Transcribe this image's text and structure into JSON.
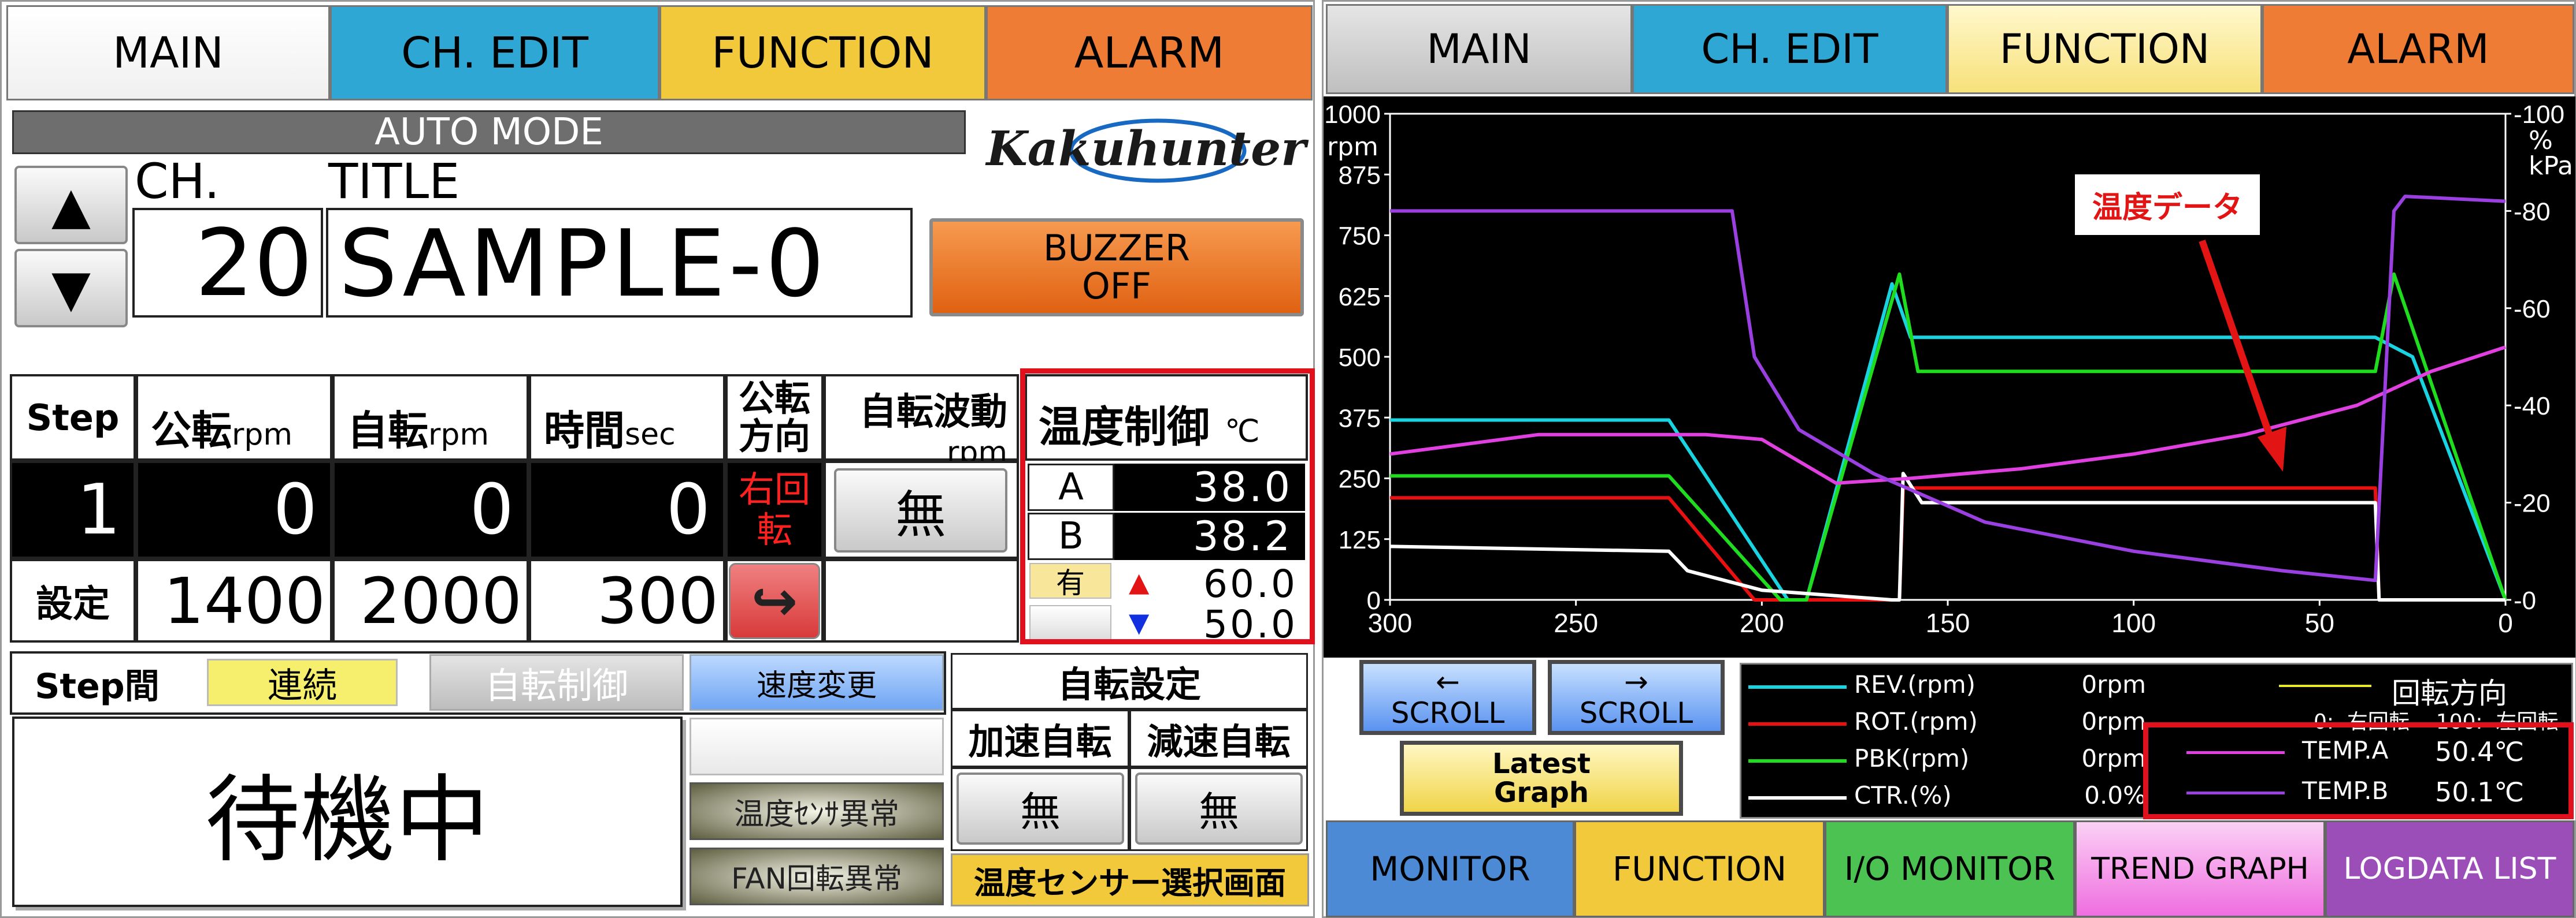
{
  "left": {
    "tabs": [
      "MAIN",
      "CH. EDIT",
      "FUNCTION",
      "ALARM"
    ],
    "mode": "AUTO MODE",
    "logo": "Kakuhunter",
    "ch_label": "CH.",
    "title_label": "TITLE",
    "ch_value": "20",
    "title_value": "SAMPLE-0",
    "up_arrow": "▲",
    "down_arrow": "▼",
    "buzzer": "BUZZER\nOFF",
    "headers": {
      "step": "Step",
      "rev": "公転",
      "rev_unit": "rpm",
      "rot": "自転",
      "rot_unit": "rpm",
      "time": "時間",
      "time_unit": "sec",
      "dir": "公転\n方向",
      "wave": "自転波動",
      "wave_unit": "rpm",
      "temp": "温度制御",
      "temp_unit": "℃"
    },
    "row1": {
      "step": "1",
      "rev": "0",
      "rot": "0",
      "time": "0",
      "dir": "右回\n転",
      "wave": "無"
    },
    "row2": {
      "label": "設定",
      "rev": "1400",
      "rot": "2000",
      "time": "300",
      "dir_icon": "↪"
    },
    "temp": {
      "a_label": "A",
      "a_value": "38.0",
      "b_label": "B",
      "b_value": "38.2",
      "flag": "有",
      "up": "▲",
      "up_value": "60.0",
      "down": "▼",
      "down_value": "50.0"
    },
    "step_between": "Step間",
    "continuous": "連続",
    "rot_control": "自転制御",
    "speed_change": "速度変更",
    "rot_setting": "自転設定",
    "accel": "加速自転",
    "decel": "減速自転",
    "accel_val": "無",
    "decel_val": "無",
    "status": "待機中",
    "sensor_error": "温度ｾﾝｻ異常",
    "fan_error": "FAN回転異常",
    "sensor_select": "温度センサー選択画面"
  },
  "right": {
    "tabs": [
      "MAIN",
      "CH. EDIT",
      "FUNCTION",
      "ALARM"
    ],
    "bottom_tabs": [
      "MONITOR",
      "FUNCTION",
      "I/O MONITOR",
      "TREND GRAPH",
      "LOGDATA LIST"
    ],
    "left_units": "rpm",
    "right_units": "%\nkPa",
    "annotation": "温度データ",
    "scroll_left": "←\nSCROLL",
    "scroll_right": "→\nSCROLL",
    "latest": "Latest\nGraph",
    "legend": [
      {
        "name": "REV.(rpm)",
        "value": "0rpm",
        "color": "#19d3e0"
      },
      {
        "name": "ROT.(rpm)",
        "value": "0rpm",
        "color": "#e81010"
      },
      {
        "name": "PBK(rpm)",
        "value": "0rpm",
        "color": "#1fdc1f"
      },
      {
        "name": "CTR.(%)",
        "value": "0.0%",
        "color": "#ffffff"
      }
    ],
    "dir_title": "回転方向",
    "dir_desc": "0:  右回転    100:  左回転",
    "temp_legend": [
      {
        "name": "TEMP.A",
        "value": "50.4℃",
        "color": "#e040e0"
      },
      {
        "name": "TEMP.B",
        "value": "50.1℃",
        "color": "#9a3fe0"
      }
    ]
  },
  "chart_data": {
    "type": "line",
    "xlim": [
      300,
      0
    ],
    "ylim": [
      0,
      1000
    ],
    "y2lim": [
      0,
      100
    ],
    "x_ticks": [
      "300",
      "250",
      "200",
      "150",
      "100",
      "50",
      "0"
    ],
    "y_ticks": [
      "1000",
      "875",
      "750",
      "625",
      "500",
      "375",
      "250",
      "125",
      "0"
    ],
    "y2_ticks": [
      "100",
      "80",
      "60",
      "40",
      "20",
      "0"
    ],
    "series": [
      {
        "name": "REV.(rpm)",
        "color": "#19d3e0",
        "points": [
          [
            300,
            370
          ],
          [
            225,
            370
          ],
          [
            193,
            0
          ],
          [
            188,
            0
          ],
          [
            165,
            650
          ],
          [
            160,
            540
          ],
          [
            35,
            540
          ],
          [
            25,
            500
          ],
          [
            0,
            0
          ]
        ]
      },
      {
        "name": "ROT.(rpm)",
        "color": "#e81010",
        "points": [
          [
            300,
            210
          ],
          [
            225,
            210
          ],
          [
            202,
            0
          ],
          [
            163,
            0
          ],
          [
            162,
            230
          ],
          [
            35,
            230
          ],
          [
            34,
            0
          ],
          [
            0,
            0
          ]
        ]
      },
      {
        "name": "PBK(rpm)",
        "color": "#1fdc1f",
        "points": [
          [
            300,
            255
          ],
          [
            225,
            255
          ],
          [
            195,
            0
          ],
          [
            188,
            0
          ],
          [
            163,
            670
          ],
          [
            158,
            470
          ],
          [
            35,
            470
          ],
          [
            30,
            670
          ],
          [
            0,
            0
          ]
        ]
      },
      {
        "name": "CTR.(%)",
        "color": "#ffffff",
        "points": [
          [
            300,
            110
          ],
          [
            225,
            100
          ],
          [
            220,
            60
          ],
          [
            200,
            20
          ],
          [
            165,
            0
          ],
          [
            163,
            0
          ],
          [
            162,
            260
          ],
          [
            157,
            200
          ],
          [
            35,
            200
          ],
          [
            34,
            0
          ],
          [
            0,
            0
          ]
        ]
      },
      {
        "name": "TEMP.A",
        "color": "#e040e0",
        "points": [
          [
            300,
            300
          ],
          [
            280,
            320
          ],
          [
            260,
            340
          ],
          [
            215,
            340
          ],
          [
            200,
            330
          ],
          [
            180,
            240
          ],
          [
            160,
            250
          ],
          [
            130,
            270
          ],
          [
            100,
            300
          ],
          [
            70,
            340
          ],
          [
            40,
            400
          ],
          [
            20,
            470
          ],
          [
            0,
            520
          ]
        ]
      },
      {
        "name": "TEMP.B",
        "color": "#9a3fe0",
        "points": [
          [
            300,
            800
          ],
          [
            208,
            800
          ],
          [
            202,
            500
          ],
          [
            190,
            350
          ],
          [
            170,
            260
          ],
          [
            140,
            160
          ],
          [
            100,
            100
          ],
          [
            60,
            60
          ],
          [
            35,
            40
          ],
          [
            30,
            800
          ],
          [
            27,
            830
          ],
          [
            0,
            820
          ]
        ]
      }
    ]
  }
}
